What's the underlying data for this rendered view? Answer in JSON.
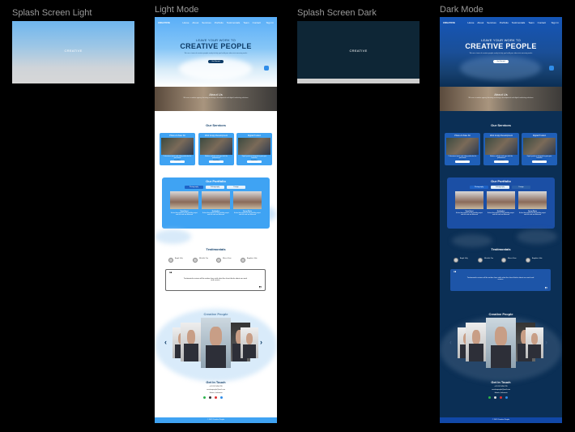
{
  "frames": {
    "splash_light": {
      "label": "Splash Screen Light",
      "logo": "CREATIVE"
    },
    "light": {
      "label": "Light Mode"
    },
    "splash_dark": {
      "label": "Splash Screen Dark",
      "logo": "CREATIVE"
    },
    "dark": {
      "label": "Dark Mode"
    }
  },
  "site": {
    "logo": "CREATIVE",
    "nav": [
      "Home",
      "About",
      "Services",
      "Portfolio",
      "Testimonials",
      "Team",
      "Contact"
    ],
    "nav_cta": "Sign In",
    "hero": {
      "pre": "LEAVE YOUR WORK TO",
      "title": "CREATIVE PEOPLE",
      "sub": "We are a team of creative people ready to help you build your ideas into amazing works",
      "button": "Get Started"
    },
    "about": {
      "title": "About Us",
      "text": "We are a creative agency focusing on design, development and digital marketing solutions"
    },
    "services": {
      "title": "Our Services",
      "items": [
        {
          "title": "Photo & Video Kit",
          "text": "Professional photo and video production for your brand",
          "button": "Read More"
        },
        {
          "title": "Web & App Development",
          "text": "Modern websites and apps built for performance",
          "button": "Read More"
        },
        {
          "title": "Digital Product",
          "text": "Digital products designed to grow your business",
          "button": "Read More"
        }
      ]
    },
    "portfolio": {
      "title": "Our Portfolio",
      "tabs": [
        "Photography",
        "Videography",
        "Design"
      ],
      "items": [
        {
          "caption": "Team Event"
        },
        {
          "caption": "Graduation"
        },
        {
          "caption": "Group Photo"
        }
      ],
      "item_text": "A short description of this portfolio project and the work we delivered"
    },
    "testimonials": {
      "title": "Testimonials",
      "people": [
        "Angel Jully",
        "Michelle Tan",
        "Marco Jhon",
        "Angelina Jolie"
      ],
      "quote": "Testimonials review will be written here with what the client thinks about our work and service"
    },
    "team": {
      "title": "Creative People"
    },
    "contact": {
      "title": "Get In Touch",
      "phone": "+62 812 3456 789",
      "email": "creativepeople@mail.com",
      "address": "Jakarta, Indonesia"
    },
    "footer": "© 2023 Creative People"
  },
  "colors": {
    "light_primary": "#3fa3f3",
    "dark_bg": "#0b2f55",
    "dark_primary": "#1f5fb8",
    "navy": "#0d3b66"
  }
}
